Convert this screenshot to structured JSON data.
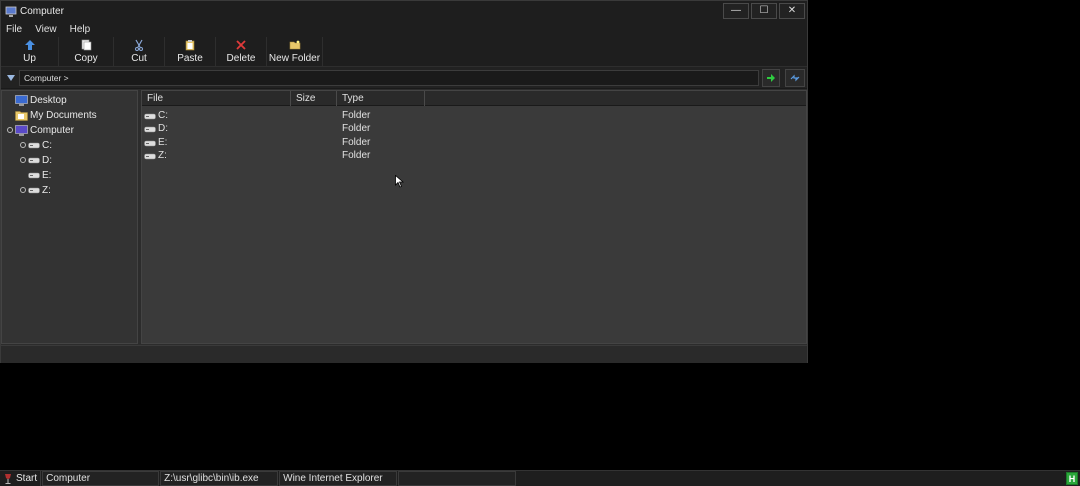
{
  "window": {
    "title": "Computer",
    "controls": {
      "minimize": "—",
      "maximize": "☐",
      "close": "✕"
    }
  },
  "menu": {
    "items": [
      "File",
      "View",
      "Help"
    ]
  },
  "toolbar": {
    "up": "Up",
    "copy": "Copy",
    "cut": "Cut",
    "paste": "Paste",
    "delete": "Delete",
    "new_folder": "New Folder"
  },
  "address": {
    "value": "Computer >"
  },
  "tree": {
    "items": [
      {
        "label": "Desktop",
        "icon": "desktop-icon"
      },
      {
        "label": "My Documents",
        "icon": "folder-icon"
      },
      {
        "label": "Computer",
        "icon": "computer-icon"
      },
      {
        "label": "C:",
        "icon": "drive-icon"
      },
      {
        "label": "D:",
        "icon": "drive-icon"
      },
      {
        "label": "E:",
        "icon": "drive-icon"
      },
      {
        "label": "Z:",
        "icon": "drive-icon"
      }
    ]
  },
  "list": {
    "columns": [
      "File",
      "Size",
      "Type"
    ],
    "rows": [
      {
        "name": "C:",
        "size": "",
        "type": "Folder"
      },
      {
        "name": "D:",
        "size": "",
        "type": "Folder"
      },
      {
        "name": "E:",
        "size": "",
        "type": "Folder"
      },
      {
        "name": "Z:",
        "size": "",
        "type": "Folder"
      }
    ]
  },
  "taskbar": {
    "start": "Start",
    "tasks": [
      "Computer",
      "Z:\\usr\\glibc\\bin\\ib.exe",
      "Wine Internet Explorer",
      ""
    ],
    "tray_icon": "H"
  },
  "colors": {
    "window_bg": "#2c2c2c",
    "titlebar_bg": "#1e1e1e",
    "list_bg": "#3a3a3a",
    "tree_bg": "#333333",
    "go_arrow": "#2ecc40",
    "tray": "#2aa63a"
  }
}
